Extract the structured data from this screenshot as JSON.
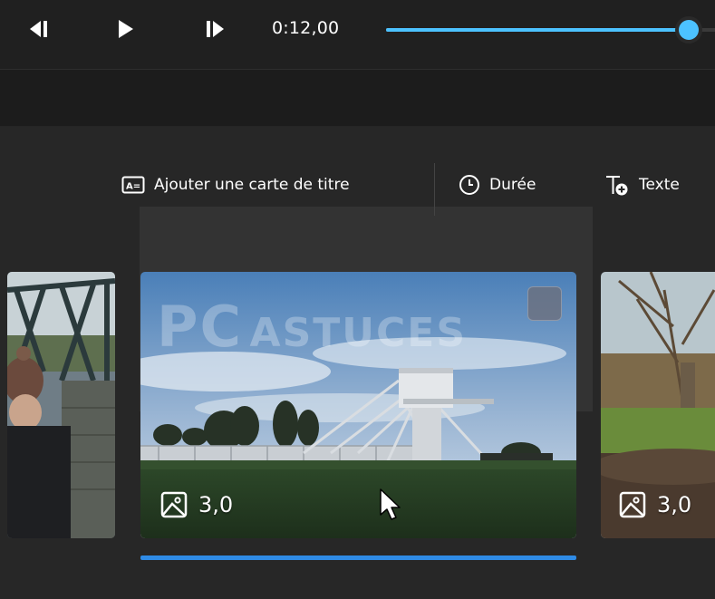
{
  "player": {
    "time": "0:12,00",
    "progress_percent": 92,
    "accent_color": "#4cc2ff"
  },
  "toolbar": {
    "add_title_card": "Ajouter une carte de titre",
    "duration": "Durée",
    "text": "Texte"
  },
  "storyboard": {
    "clips": [
      {
        "icon": "image-icon",
        "duration": ""
      },
      {
        "icon": "image-icon",
        "duration": "3,0",
        "selected": true
      },
      {
        "icon": "image-icon",
        "duration": "3,0"
      }
    ],
    "watermark": {
      "big": "PC",
      "small": "ASTUCES"
    },
    "selection_color": "#2f8be6"
  }
}
